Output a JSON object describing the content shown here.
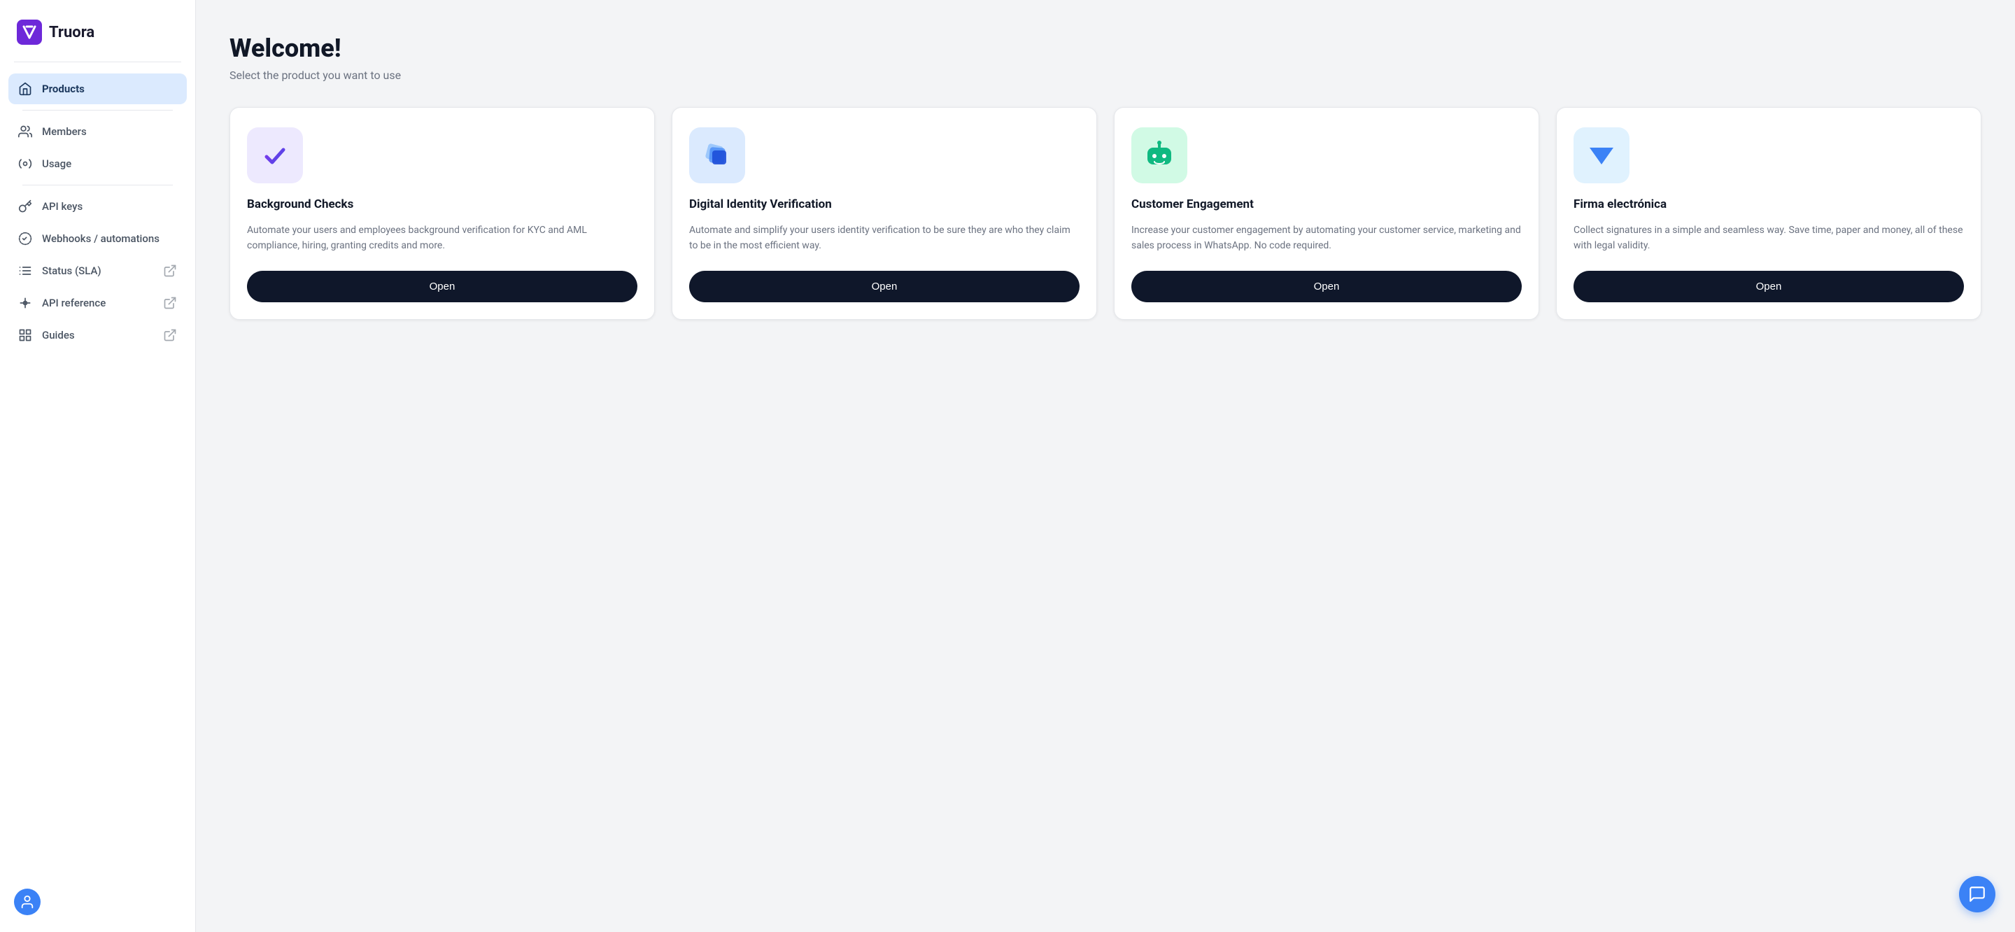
{
  "logo": {
    "text": "Truora"
  },
  "sidebar": {
    "items": [
      {
        "id": "products",
        "label": "Products",
        "icon": "home-icon",
        "active": true,
        "external": false
      },
      {
        "id": "members",
        "label": "Members",
        "icon": "users-icon",
        "active": false,
        "external": false
      },
      {
        "id": "usage",
        "label": "Usage",
        "icon": "settings-icon",
        "active": false,
        "external": false
      },
      {
        "id": "api-keys",
        "label": "API keys",
        "icon": "key-icon",
        "active": false,
        "external": false
      },
      {
        "id": "webhooks",
        "label": "Webhooks / automations",
        "icon": "webhook-icon",
        "active": false,
        "external": false
      },
      {
        "id": "status",
        "label": "Status (SLA)",
        "icon": "status-icon",
        "active": false,
        "external": true
      },
      {
        "id": "api-reference",
        "label": "API reference",
        "icon": "api-icon",
        "active": false,
        "external": true
      },
      {
        "id": "guides",
        "label": "Guides",
        "icon": "guides-icon",
        "active": false,
        "external": true
      }
    ]
  },
  "page": {
    "title": "Welcome!",
    "subtitle": "Select the product you want to use"
  },
  "products": [
    {
      "id": "background-checks",
      "title": "Background Checks",
      "description": "Automate your users and employees background verification for KYC and AML compliance, hiring, granting credits and more.",
      "icon_color": "purple",
      "button_label": "Open"
    },
    {
      "id": "digital-identity",
      "title": "Digital Identity Verification",
      "description": "Automate and simplify your users identity verification to be sure they are who they claim to be in the most efficient way.",
      "icon_color": "blue",
      "button_label": "Open"
    },
    {
      "id": "customer-engagement",
      "title": "Customer Engagement",
      "description": "Increase your customer engagement by automating your customer service, marketing and sales process in WhatsApp. No code required.",
      "icon_color": "teal",
      "button_label": "Open"
    },
    {
      "id": "firma-electronica",
      "title": "Firma electrónica",
      "description": "Collect signatures in a simple and seamless way. Save time, paper and money, all of these with legal validity.",
      "icon_color": "lightblue",
      "button_label": "Open"
    }
  ]
}
